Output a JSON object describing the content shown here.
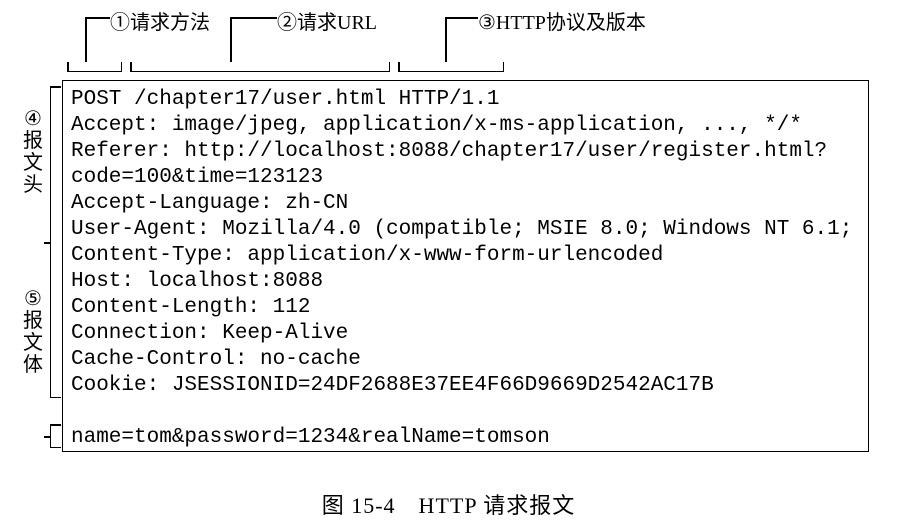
{
  "annotations": {
    "top": {
      "method": "①请求方法",
      "url": "②请求URL",
      "protocol": "③HTTP协议及版本"
    },
    "left": {
      "header_num": "④",
      "header_text": "报文头",
      "body_num": "⑤",
      "body_text": "报文体"
    }
  },
  "request": {
    "line1": "POST /chapter17/user.html HTTP/1.1",
    "line2": "Accept: image/jpeg, application/x-ms-application, ..., */*",
    "line3": "Referer: http://localhost:8088/chapter17/user/register.html?",
    "line4": "code=100&time=123123",
    "line5": "Accept-Language: zh-CN",
    "line6": "User-Agent: Mozilla/4.0 (compatible; MSIE 8.0; Windows NT 6.1;",
    "line7": "Content-Type: application/x-www-form-urlencoded",
    "line8": "Host: localhost:8088",
    "line9": "Content-Length: 112",
    "line10": "Connection: Keep-Alive",
    "line11": "Cache-Control: no-cache",
    "line12": "Cookie: JSESSIONID=24DF2688E37EE4F66D9669D2542AC17B",
    "blank": "",
    "body": "name=tom&password=1234&realName=tomson"
  },
  "caption": "图 15-4　HTTP 请求报文"
}
